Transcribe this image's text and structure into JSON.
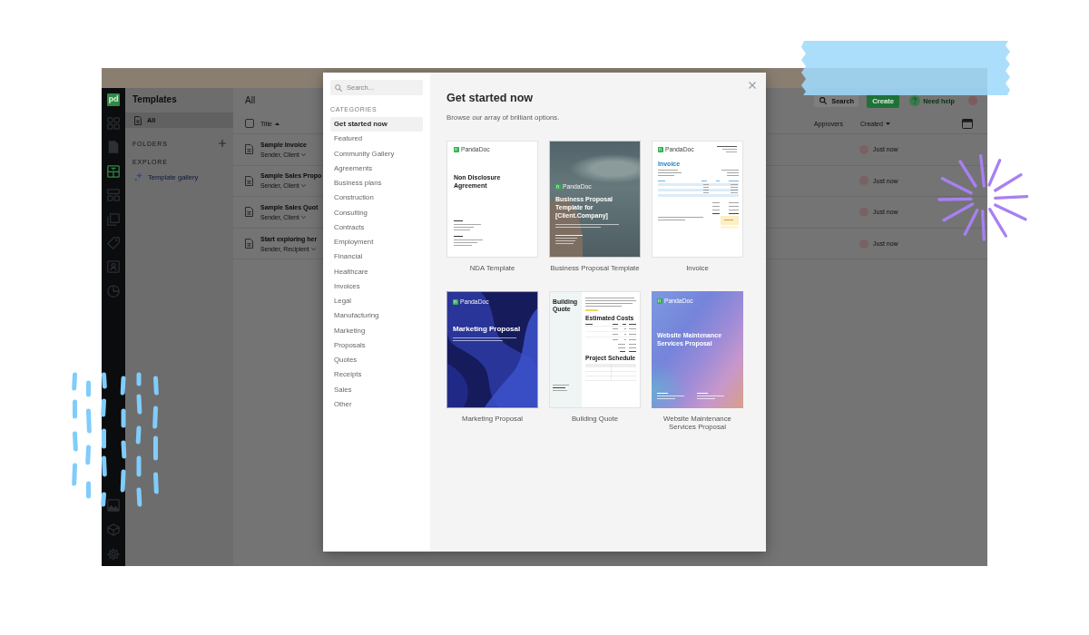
{
  "app": {
    "logo": "pd",
    "rail_top": [
      {
        "kind": "grid",
        "selected": false
      },
      {
        "kind": "document",
        "selected": false
      },
      {
        "kind": "template",
        "selected": true
      },
      {
        "kind": "layout",
        "selected": false
      },
      {
        "kind": "form",
        "selected": false
      },
      {
        "kind": "tag",
        "selected": false
      },
      {
        "kind": "contact",
        "selected": false
      },
      {
        "kind": "chart",
        "selected": false
      }
    ],
    "rail_bottom": [
      {
        "kind": "image",
        "selected": false
      },
      {
        "kind": "cube",
        "selected": false
      },
      {
        "kind": "settings",
        "selected": false
      }
    ],
    "sidebar": {
      "title": "Templates",
      "items": [
        {
          "label": "All",
          "selected": true
        }
      ],
      "folders_label": "FOLDERS",
      "explore_label": "EXPLORE",
      "explore_items": [
        {
          "label": "Template gallery"
        }
      ]
    },
    "header": {
      "title": "All",
      "search_button": "Search",
      "create_button": "Create",
      "help_link": "Need help"
    },
    "table": {
      "select_all": {
        "checked": false
      },
      "columns": [
        "Title",
        "Approvers",
        "Created"
      ],
      "rows": [
        {
          "title": "Sample Invoice",
          "recipients": "Sender, Client",
          "created": "Just now"
        },
        {
          "title": "Sample Sales Propo",
          "recipients": "Sender, Client",
          "created": "Just now"
        },
        {
          "title": "Sample Sales Quot",
          "recipients": "Sender, Client",
          "created": "Just now"
        },
        {
          "title": "Start exploring her",
          "recipients": "Sender, Recipient",
          "created": "Just now"
        }
      ]
    }
  },
  "modal": {
    "search": {
      "placeholder": "Search..."
    },
    "categories_label": "CATEGORIES",
    "categories": [
      {
        "label": "Get started now",
        "selected": true
      },
      {
        "label": "Featured",
        "selected": false
      },
      {
        "label": "Community Gallery",
        "selected": false
      },
      {
        "label": "Agreements",
        "selected": false
      },
      {
        "label": "Business plans",
        "selected": false
      },
      {
        "label": "Construction",
        "selected": false
      },
      {
        "label": "Consulting",
        "selected": false
      },
      {
        "label": "Contracts",
        "selected": false
      },
      {
        "label": "Employment",
        "selected": false
      },
      {
        "label": "Financial",
        "selected": false
      },
      {
        "label": "Healthcare",
        "selected": false
      },
      {
        "label": "Invoices",
        "selected": false
      },
      {
        "label": "Legal",
        "selected": false
      },
      {
        "label": "Manufacturing",
        "selected": false
      },
      {
        "label": "Marketing",
        "selected": false
      },
      {
        "label": "Proposals",
        "selected": false
      },
      {
        "label": "Quotes",
        "selected": false
      },
      {
        "label": "Receipts",
        "selected": false
      },
      {
        "label": "Sales",
        "selected": false
      },
      {
        "label": "Other",
        "selected": false
      }
    ],
    "title": "Get started now",
    "subtitle": "Browse our array of brilliant options.",
    "templates": [
      {
        "name": "NDA Template",
        "kind": "nda",
        "preview": {
          "brand": "PandaDoc",
          "heading": "Non Disclosure Agreement"
        }
      },
      {
        "name": "Business Proposal Template",
        "kind": "proposal",
        "preview": {
          "brand": "PandaDoc",
          "heading": "Business Proposal Template for [Client.Company]"
        }
      },
      {
        "name": "Invoice",
        "kind": "invoice",
        "preview": {
          "brand": "PandaDoc",
          "heading": "Invoice"
        }
      },
      {
        "name": "Marketing Proposal",
        "kind": "marketing",
        "preview": {
          "brand": "PandaDoc",
          "heading": "Marketing Proposal"
        }
      },
      {
        "name": "Building Quote",
        "kind": "quote",
        "preview": {
          "heading": "Building Quote",
          "sections": [
            "Estimated Costs",
            "Project Schedule"
          ]
        }
      },
      {
        "name": "Website Maintenance Services Proposal",
        "kind": "website",
        "preview": {
          "brand": "PandaDoc",
          "heading": "Website Maintenance Services Proposal"
        }
      }
    ]
  }
}
